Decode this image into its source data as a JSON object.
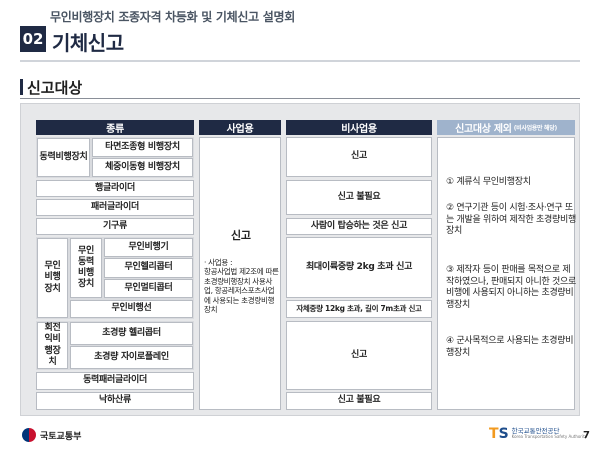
{
  "header": {
    "subtitle": "무인비행장치 조종자격 차등화 및 기체신고 설명회",
    "section_number": "02",
    "title": "기체신고"
  },
  "section": {
    "title": "신고대상"
  },
  "table": {
    "col_headers": {
      "kind": "종류",
      "business": "사업용",
      "nonbusiness": "비사업용",
      "exempt": "신고대상 제외",
      "exempt_note": "(비사업용만 해당)"
    },
    "kinds": {
      "powered_aircraft": "동력비행장치",
      "weight_shift": "타면조종형 비행장치",
      "weight_shift2": "체중이동형 비행장치",
      "glider": "행글라이더",
      "paraglider": "패러글라이더",
      "balloon": "기구류",
      "unmanned": "무인비행장치",
      "unmanned_powered": "무인동력비행장치",
      "drone_plane": "무인비행기",
      "drone_heli": "무인헬리콥터",
      "drone_multi": "무인멀티콥터",
      "drone_ship": "무인비행선",
      "rotorcraft": "회전익비행장치",
      "ultralight_heli": "초경량 헬리콥터",
      "ultralight_gyro": "초경량 자이로플레인",
      "powered_paraglider": "동력패러글라이더",
      "parachute": "낙하산류"
    },
    "business": {
      "main": "신고",
      "note_title": "· 사업용 :",
      "note_body": "항공사업법 제2조에 따른 초경량비행장치 사용사업, 항공레저스포츠사업에 사용되는 초경량비행장치"
    },
    "nonbusiness": {
      "r1": "신고",
      "r2": "신고 불필요",
      "r3": "사람이 탑승하는 것은 신고",
      "r4": "최대이륙중량 2kg 초과 신고",
      "r5": "자체중량 12kg 초과, 길이 7m초과 신고",
      "r6": "신고",
      "r7": "신고 불필요"
    },
    "exempt": [
      "① 계류식 무인비행장치",
      "② 연구기관 등이 시험·조사·연구 또는 개발을 위하여 제작한 초경량비행장치",
      "③ 제작자 등이 판매를 목적으로 제작하였으나, 판매되지 아니한 것으로 비행에 사용되지 아니하는 초경량비행장치",
      "④ 군사목적으로 사용되는 초경량비행장치"
    ]
  },
  "footer": {
    "left_org": "국토교통부",
    "right_mark_a": "T",
    "right_mark_b": "S",
    "right_org": "한국교통안전공단",
    "right_org_en": "Korea Transportation Safety Authority",
    "page": "7"
  }
}
